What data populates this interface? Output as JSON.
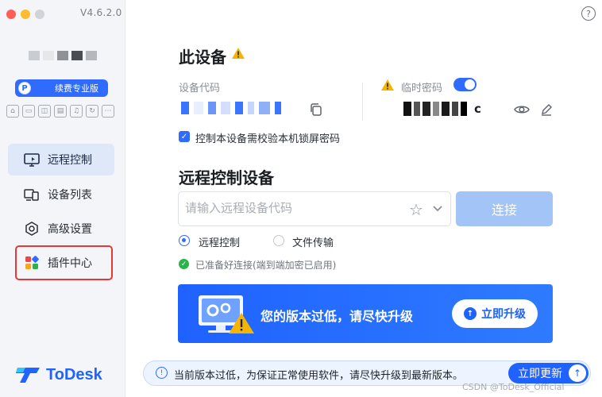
{
  "window": {
    "version": "V4.6.2.0",
    "traffic_lights": [
      "#ff5f57",
      "#febc2e",
      "#d0d3d8"
    ]
  },
  "sidebar": {
    "plan_badge": {
      "icon_letter": "P",
      "label": "续费专业版"
    },
    "nav": [
      {
        "label": "远程控制",
        "icon": "monitor-icon",
        "active": true
      },
      {
        "label": "设备列表",
        "icon": "devices-icon",
        "active": false
      },
      {
        "label": "高级设置",
        "icon": "gear-hex-icon",
        "active": false
      },
      {
        "label": "插件中心",
        "icon": "plugin-grid-icon",
        "active": false,
        "highlighted": true
      }
    ],
    "logo_text": "ToDesk"
  },
  "main": {
    "device_title": "此设备",
    "device_code_label": "设备代码",
    "temp_password_label": "临时密码",
    "temp_password_suffix": "c",
    "lock_check_label": "控制本设备需校验本机锁屏密码",
    "remote_title": "远程控制设备",
    "remote_input_placeholder": "请输入远程设备代码",
    "connect_button": "连接",
    "modes": [
      {
        "label": "远程控制",
        "selected": true
      },
      {
        "label": "文件传输",
        "selected": false
      }
    ],
    "ready_text": "已准备好连接(端到端加密已启用)",
    "banner": {
      "text": "您的版本过低，请尽快升级",
      "button": "立即升级"
    },
    "notice": {
      "text": "当前版本过低，为保证正常使用软件，请尽快升级到最新版本。",
      "button": "立即更新"
    },
    "watermark": "CSDN @ToDesk_Official"
  },
  "colors": {
    "accent": "#2f6bff",
    "warning": "#f5b400",
    "highlight_outline": "#e53935"
  }
}
